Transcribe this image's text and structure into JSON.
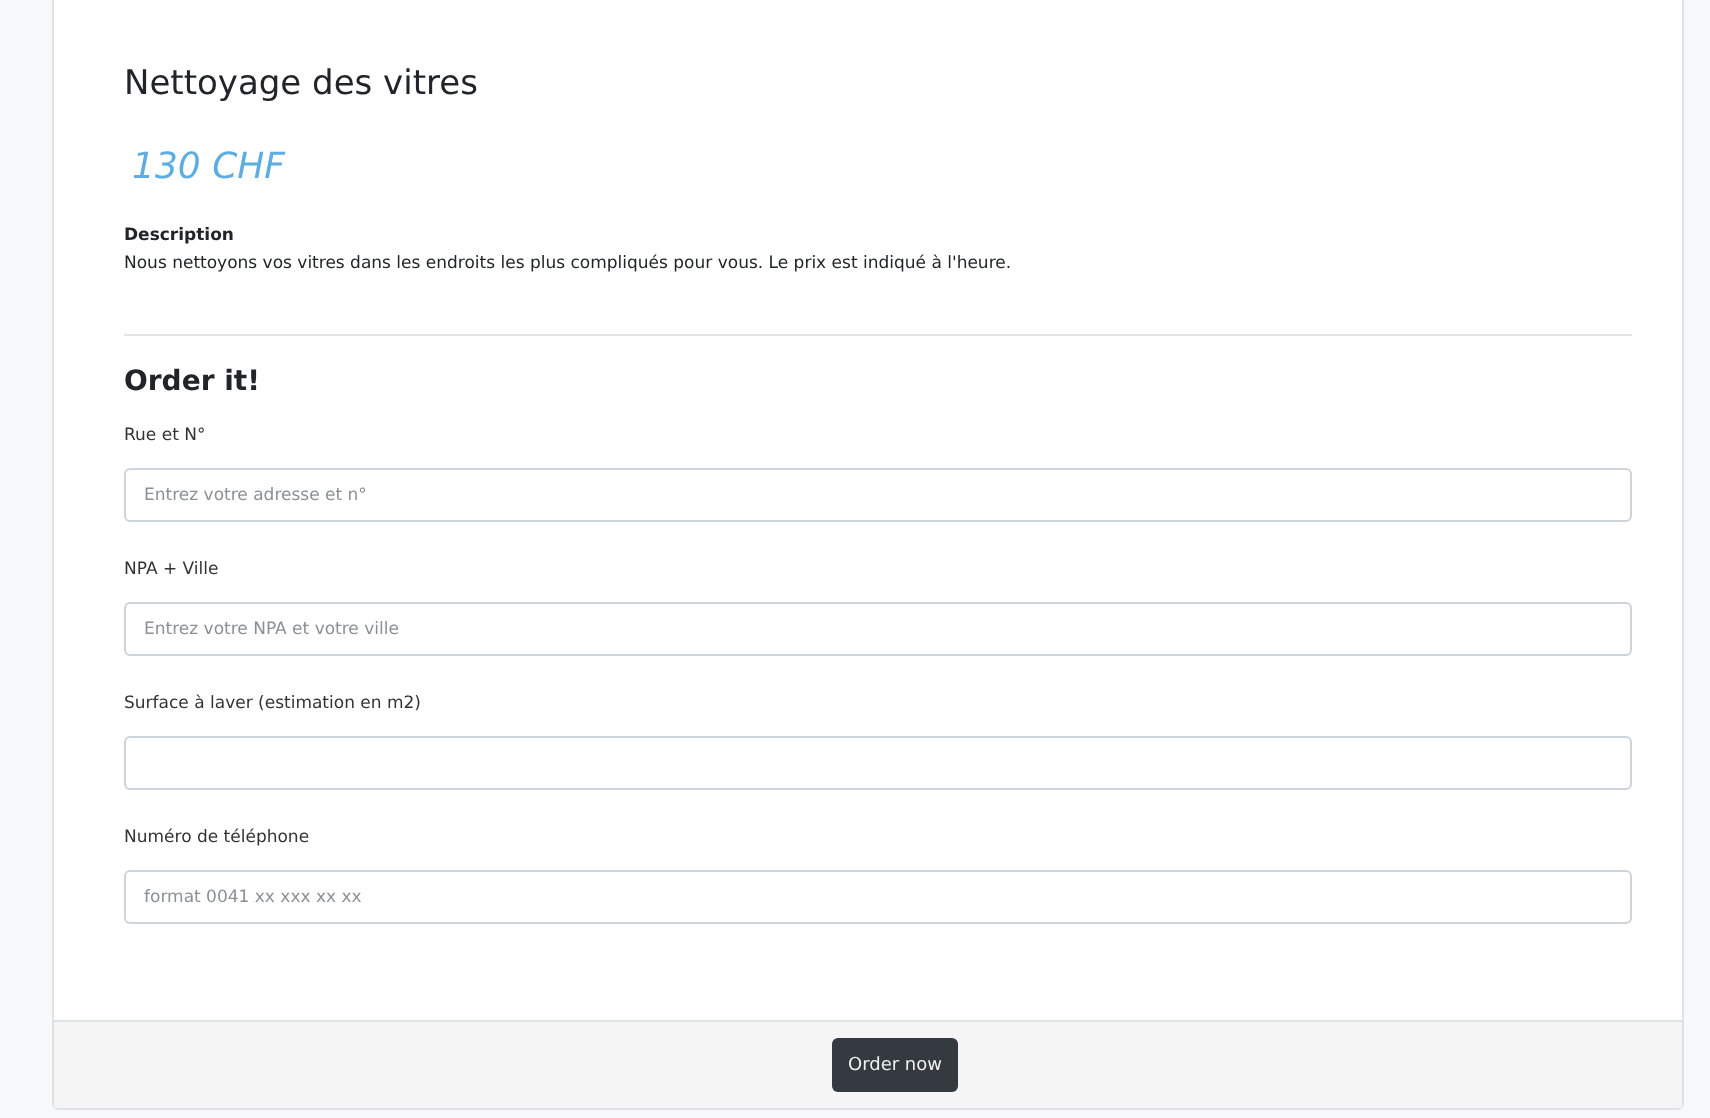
{
  "service": {
    "title": "Nettoyage des vitres",
    "price": "130 CHF",
    "description_heading": "Description",
    "description": "Nous nettoyons vos vitres dans les endroits les plus compliqués pour vous. Le prix est indiqué à l'heure."
  },
  "order_form": {
    "heading": "Order it!",
    "fields": [
      {
        "label": "Rue et N°",
        "placeholder": "Entrez votre adresse et n°"
      },
      {
        "label": "NPA + Ville",
        "placeholder": "Entrez votre NPA et votre ville"
      },
      {
        "label": "Surface à laver (estimation en m2)"
      },
      {
        "label": "Numéro de téléphone",
        "placeholder": "format 0041 xx xxx xx xx"
      }
    ],
    "submit": "Order now"
  }
}
